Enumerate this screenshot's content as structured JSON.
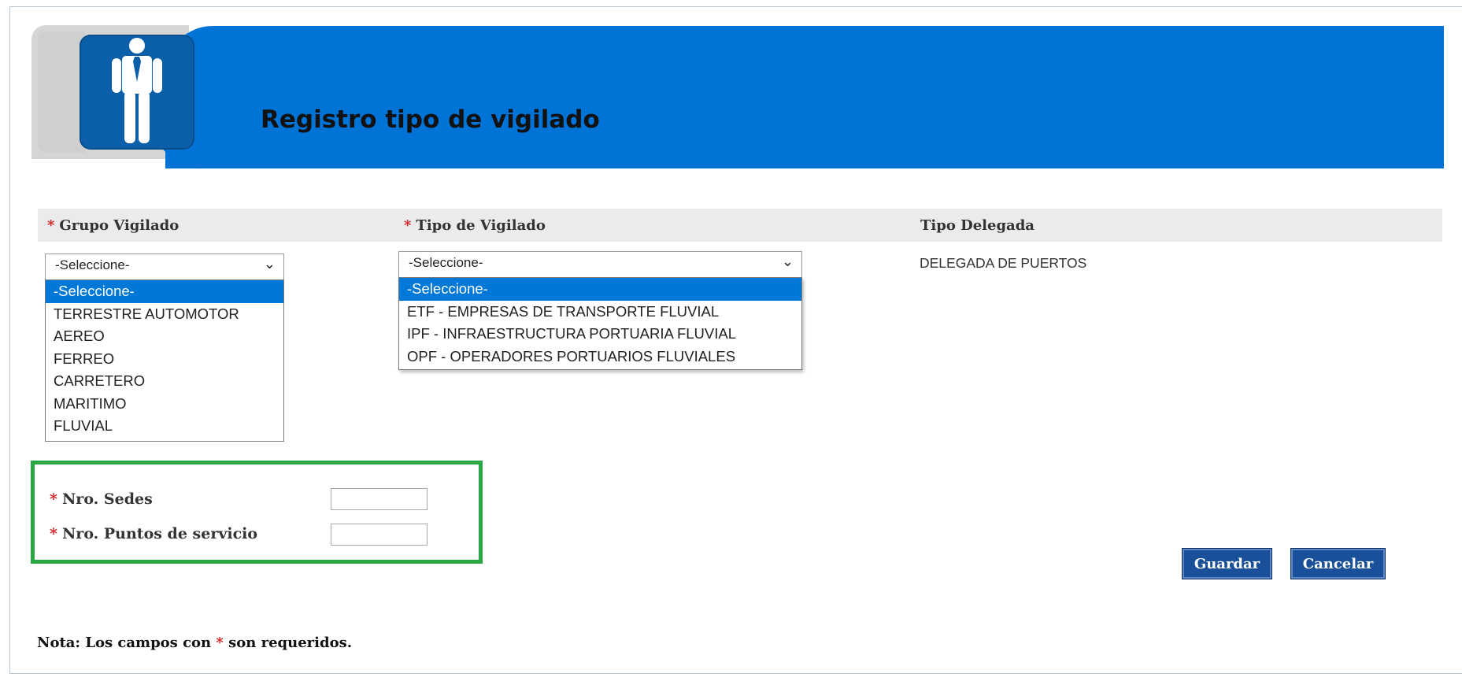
{
  "page": {
    "title": "Registro tipo de vigilado",
    "icon": "person-tie-icon"
  },
  "colors": {
    "banner_blue": "#0073d6",
    "icon_box": "#0b5fa8",
    "required_star": "#d02020",
    "highlight_box": "#27a844",
    "button": "#1a4f9a",
    "selected_option": "#0078d7"
  },
  "form": {
    "required_mark": "*",
    "grupo": {
      "label": "Grupo Vigilado",
      "selected": "-Seleccione-",
      "options": [
        "-Seleccione-",
        "TERRESTRE AUTOMOTOR",
        "AEREO",
        "FERREO",
        "CARRETERO",
        "MARITIMO",
        "FLUVIAL"
      ]
    },
    "tipo": {
      "label": "Tipo de Vigilado",
      "selected": "-Seleccione-",
      "options": [
        "-Seleccione-",
        "ETF - EMPRESAS DE TRANSPORTE FLUVIAL",
        "IPF - INFRAESTRUCTURA PORTUARIA FLUVIAL",
        "OPF - OPERADORES PORTUARIOS FLUVIALES"
      ]
    },
    "delegada": {
      "label": "Tipo Delegada",
      "value": "DELEGADA DE PUERTOS"
    },
    "sedes": {
      "label": "Nro. Sedes",
      "value": ""
    },
    "puntos": {
      "label": "Nro. Puntos de servicio",
      "value": ""
    }
  },
  "buttons": {
    "guardar": "Guardar",
    "cancelar": "Cancelar"
  },
  "note": {
    "prefix": "Nota: Los campos con",
    "star": "*",
    "suffix": "son requeridos."
  }
}
